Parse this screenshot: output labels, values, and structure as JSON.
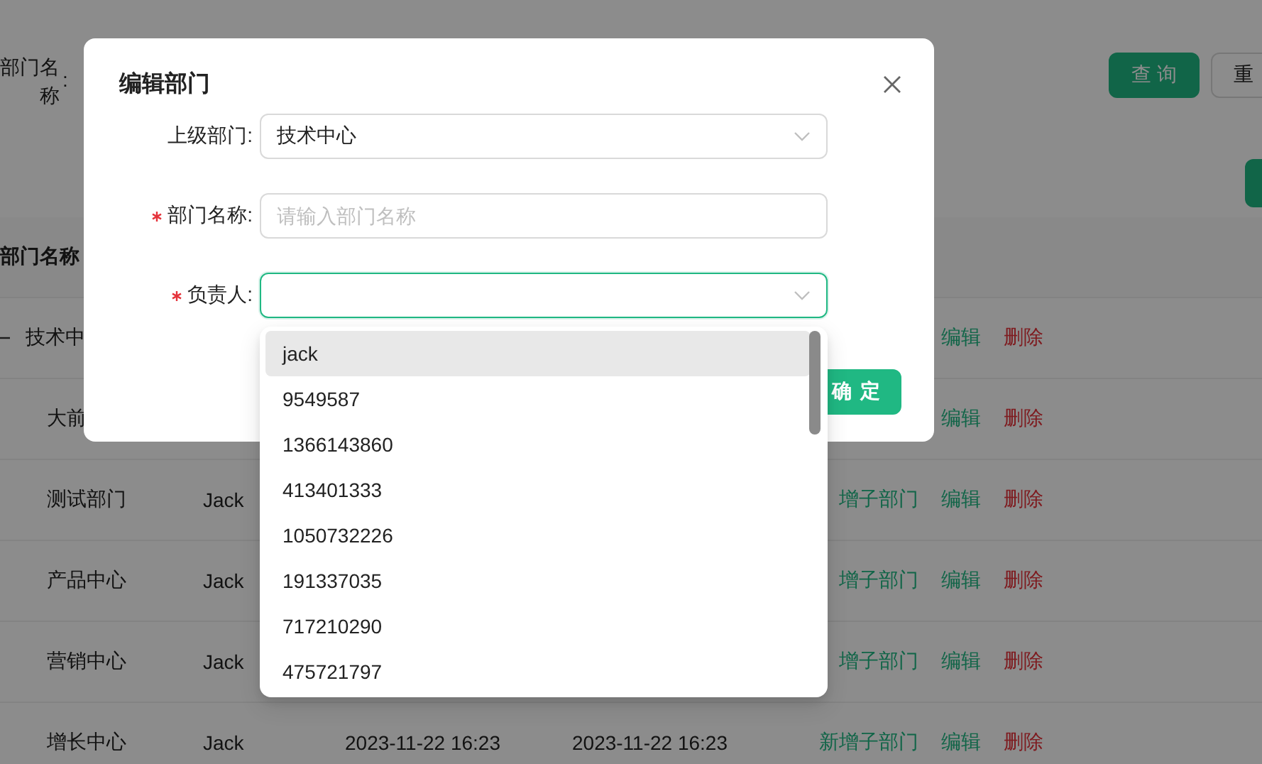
{
  "search": {
    "label": "部门名称",
    "separator": ":",
    "buttons": [
      {
        "label": "查 询",
        "kind": "primary"
      },
      {
        "label": "重",
        "kind": "default"
      }
    ]
  },
  "toolbar": {
    "buttons": [
      {
        "kind": "primary"
      }
    ]
  },
  "table": {
    "columns": [
      "部门名称"
    ],
    "rows": [
      {
        "name": "技术中",
        "expanded": true,
        "actions": [
          {
            "label": "编辑",
            "kind": "link"
          },
          {
            "label": "删除",
            "kind": "danger"
          }
        ],
        "children": [
          {
            "name": "大前",
            "actions": [
              {
                "label": "编辑",
                "kind": "link"
              },
              {
                "label": "删除",
                "kind": "danger"
              }
            ]
          },
          {
            "name": "测试部门",
            "person": "Jack",
            "actions": [
              {
                "label": "增子部门",
                "kind": "link"
              },
              {
                "label": "编辑",
                "kind": "link"
              },
              {
                "label": "删除",
                "kind": "danger"
              }
            ]
          },
          {
            "name": "产品中心",
            "person": "Jack",
            "actions": [
              {
                "label": "增子部门",
                "kind": "link"
              },
              {
                "label": "编辑",
                "kind": "link"
              },
              {
                "label": "删除",
                "kind": "danger"
              }
            ]
          },
          {
            "name": "营销中心",
            "person": "Jack",
            "actions": [
              {
                "label": "增子部门",
                "kind": "link"
              },
              {
                "label": "编辑",
                "kind": "link"
              },
              {
                "label": "删除",
                "kind": "danger"
              }
            ]
          },
          {
            "name": "增长中心",
            "person": "Jack",
            "created": "2023-11-22 16:23",
            "updated": "2023-11-22 16:23",
            "actions": [
              {
                "label": "新增子部门",
                "kind": "link"
              },
              {
                "label": "编辑",
                "kind": "link"
              },
              {
                "label": "删除",
                "kind": "danger"
              }
            ]
          }
        ]
      }
    ]
  },
  "modal": {
    "title": "编辑部门",
    "fields": [
      {
        "label": "上级部门:",
        "required": false,
        "kind": "select",
        "value": "技术中心",
        "focused": false
      },
      {
        "label": "部门名称:",
        "required": true,
        "kind": "input",
        "placeholder": "请输入部门名称",
        "focused": false
      },
      {
        "label": "负责人:",
        "required": true,
        "kind": "select",
        "focused": true
      }
    ],
    "footer_buttons": [
      {
        "label": "确 定",
        "kind": "primary"
      }
    ]
  },
  "dropdown": {
    "options": [
      {
        "label": "jack",
        "selected": true
      },
      {
        "label": "9549587",
        "selected": false
      },
      {
        "label": "1366143860",
        "selected": false
      },
      {
        "label": "413401333",
        "selected": false
      },
      {
        "label": "1050732226",
        "selected": false
      },
      {
        "label": "191337035",
        "selected": false
      },
      {
        "label": "717210290",
        "selected": false
      },
      {
        "label": "475721797",
        "selected": false
      }
    ]
  }
}
